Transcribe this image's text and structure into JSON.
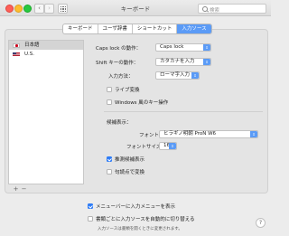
{
  "window": {
    "title": "キーボード",
    "search_placeholder": "検索"
  },
  "tabs": [
    {
      "label": "キーボード",
      "active": false
    },
    {
      "label": "ユーザ辞書",
      "active": false
    },
    {
      "label": "ショートカット",
      "active": false
    },
    {
      "label": "入力ソース",
      "active": true
    }
  ],
  "sources": [
    {
      "label": "日本語",
      "flag": "japan-flag-icon",
      "selected": true
    },
    {
      "label": "U.S.",
      "flag": "us-flag-icon",
      "selected": false
    }
  ],
  "list_controls": {
    "add": "+",
    "remove": "−"
  },
  "settings": {
    "caps_lock_label": "Caps lock の動作：",
    "caps_lock_value": "Caps lock",
    "shift_label": "Shift キーの動作：",
    "shift_value": "カタカナを入力",
    "input_method_label": "入力方法：",
    "input_method_value": "ローマ字入力",
    "live_conversion": {
      "label": "ライブ変換",
      "checked": false
    },
    "windows_keys": {
      "label": "Windows 風のキー操作",
      "checked": false
    },
    "candidates_header": "候補表示：",
    "font_label": "フォント：",
    "font_value": "ヒラギノ明朝 ProN W6",
    "font_size_label": "フォントサイズ：",
    "font_size_value": "16",
    "predictive": {
      "label": "推測候補表示",
      "checked": true
    },
    "full_width_conversion": {
      "label": "句読点で変換",
      "checked": false
    }
  },
  "footer": {
    "show_menu": {
      "label": "メニューバーに入力メニューを表示",
      "checked": true
    },
    "auto_switch": {
      "label": "書類ごとに入力ソースを自動的に切り替える",
      "checked": false
    },
    "note": "入力ソースは書類を開くときに変更されます。"
  },
  "help": "?"
}
